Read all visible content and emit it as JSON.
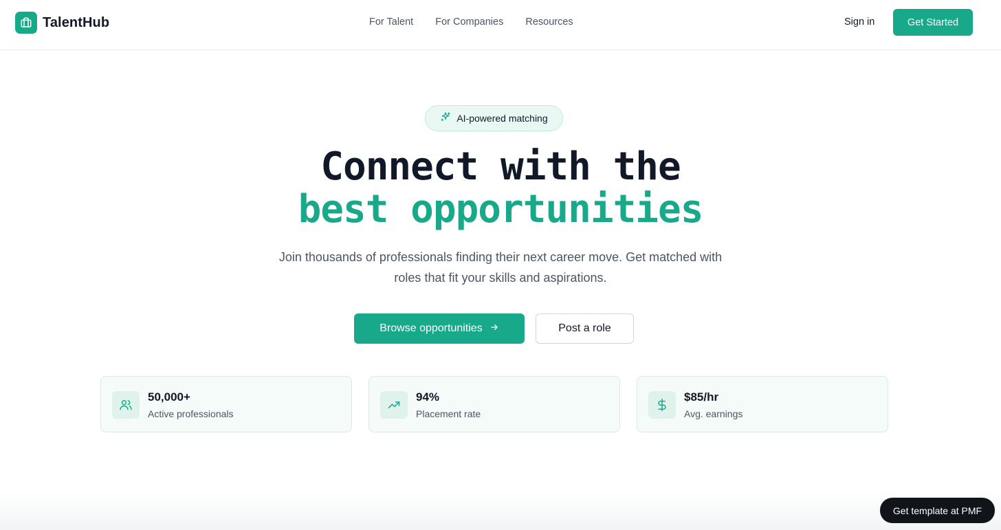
{
  "brand": {
    "name": "TalentHub",
    "accent": "#17a98a",
    "logo_icon": "briefcase-icon"
  },
  "nav": {
    "links": [
      "For Talent",
      "For Companies",
      "Resources"
    ],
    "sign_in": "Sign in",
    "get_started": "Get Started"
  },
  "hero": {
    "badge": {
      "icon": "sparkles-icon",
      "label": "AI-powered matching"
    },
    "headline_line1": "Connect with the",
    "headline_line2": "best opportunities",
    "subtext": "Join thousands of professionals finding their next career move. Get matched with roles that fit your skills and aspirations.",
    "primary_cta": {
      "label": "Browse opportunities",
      "icon": "arrow-right-icon"
    },
    "secondary_cta": {
      "label": "Post a role"
    }
  },
  "stats": [
    {
      "icon": "users-icon",
      "value": "50,000+",
      "label": "Active professionals"
    },
    {
      "icon": "trending-up-icon",
      "value": "94%",
      "label": "Placement rate"
    },
    {
      "icon": "dollar-icon",
      "value": "$85/hr",
      "label": "Avg. earnings"
    }
  ],
  "floating_cta": {
    "label": "Get template at PMF"
  }
}
